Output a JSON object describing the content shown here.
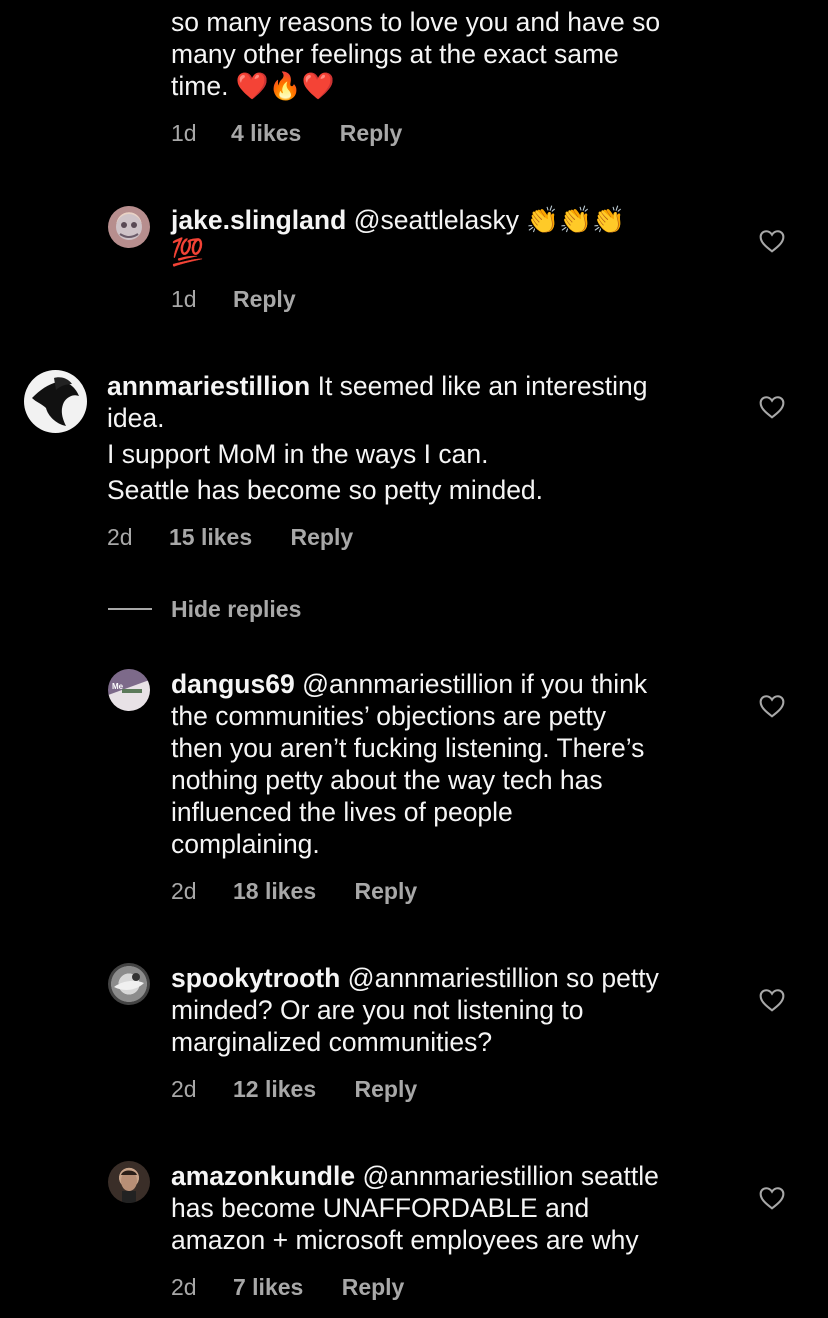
{
  "comments": [
    {
      "lines": [
        "so many reasons to love you and have so",
        "many other feelings at the exact same",
        "time. ❤️🔥❤️"
      ],
      "age": "1d",
      "likes": "4 likes",
      "reply": "Reply"
    },
    {
      "username": "jake.slingland",
      "line1_rest": " @seattlelasky 👏👏👏",
      "line2": "💯",
      "age": "1d",
      "reply": "Reply"
    },
    {
      "username": "annmariestillion",
      "line1_rest": " It seemed like an interesting",
      "lines": [
        "idea.",
        "I support MoM in the ways I can.",
        "Seattle has become so petty minded."
      ],
      "age": "2d",
      "likes": "15 likes",
      "reply": "Reply"
    },
    {
      "username": "dangus69",
      "line1_rest": " @annmariestillion if you think",
      "lines": [
        "the communities’ objections are petty",
        "then you aren’t fucking listening. There’s",
        "nothing petty about the way tech has",
        "influenced the lives of people",
        "complaining."
      ],
      "age": "2d",
      "likes": "18 likes",
      "reply": "Reply"
    },
    {
      "username": "spookytrooth",
      "line1_rest": " @annmariestillion so petty",
      "lines": [
        "minded? Or are you not listening to",
        "marginalized communities?"
      ],
      "age": "2d",
      "likes": "12 likes",
      "reply": "Reply"
    },
    {
      "username": "amazonkundle",
      "line1_rest": " @annmariestillion seattle",
      "lines": [
        "has become UNAFFORDABLE and",
        "amazon + microsoft employees are why"
      ],
      "age": "2d",
      "likes": "7 likes",
      "reply": "Reply"
    }
  ],
  "hide_replies": "Hide replies",
  "icons": {
    "like": "heart-icon"
  },
  "colors": {
    "background": "#000000",
    "text": "#f5f5f5",
    "meta": "#a8a8a8"
  }
}
